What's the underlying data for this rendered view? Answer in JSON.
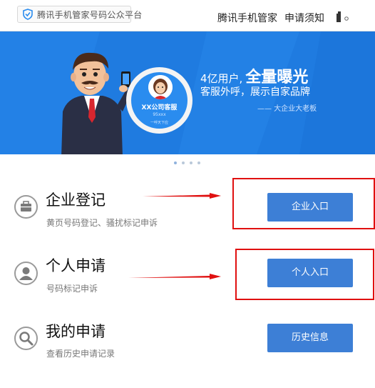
{
  "header": {
    "logo_text": "腾讯手机管家号码公众平台",
    "nav": [
      "腾讯手机管家",
      "申请须知"
    ]
  },
  "banner": {
    "slogan_line1_prefix": "4亿用户,",
    "slogan_line1_emphasis": "全量曝光",
    "slogan_line2": "客服外呼，展示自家品牌",
    "slogan_line3": "—— 大企业大老板",
    "card_title": "XX公司客服",
    "card_number": "95xxx",
    "card_cta": "一呼天下应",
    "carousel_dots": 4
  },
  "rows": [
    {
      "title": "企业登记",
      "subtitle": "黄页号码登记、骚扰标记申诉",
      "button": "企业入口",
      "icon": "briefcase-icon"
    },
    {
      "title": "个人申请",
      "subtitle": "号码标记申诉",
      "button": "个人入口",
      "icon": "person-icon"
    },
    {
      "title": "我的申请",
      "subtitle": "查看历史申请记录",
      "button": "历史信息",
      "icon": "search-icon"
    }
  ],
  "colors": {
    "banner_blue": "#1f7be0",
    "button_blue": "#3d7fd6",
    "annotation_red": "#e01010"
  }
}
